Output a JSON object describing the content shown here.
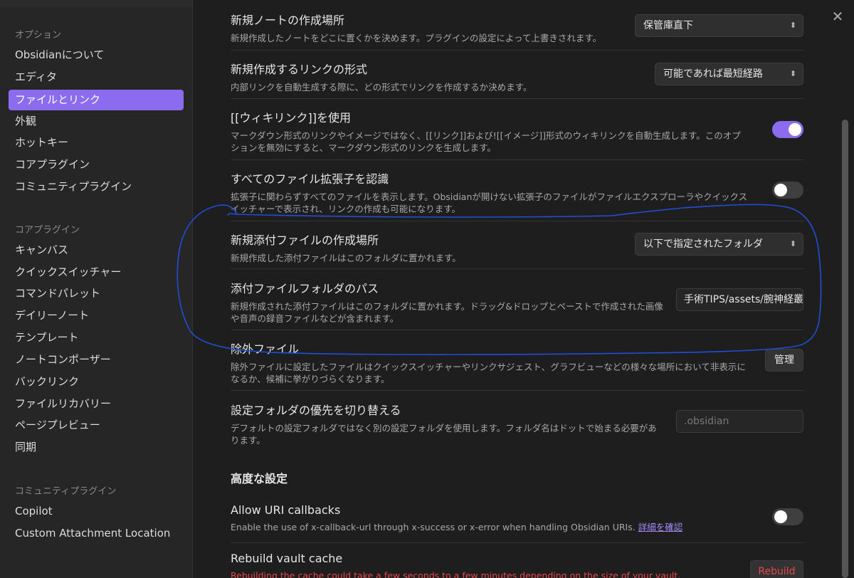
{
  "sidebar": {
    "groups": [
      {
        "title": "オプション",
        "items": [
          "Obsidianについて",
          "エディタ",
          "ファイルとリンク",
          "外観",
          "ホットキー",
          "コアプラグイン",
          "コミュニティプラグイン"
        ]
      },
      {
        "title": "コアプラグイン",
        "items": [
          "キャンバス",
          "クイックスイッチャー",
          "コマンドパレット",
          "デイリーノート",
          "テンプレート",
          "ノートコンポーザー",
          "バックリンク",
          "ファイルリカバリー",
          "ページプレビュー",
          "同期"
        ]
      },
      {
        "title": "コミュニティプラグイン",
        "items": [
          "Copilot",
          "Custom Attachment Location"
        ]
      }
    ],
    "active_item": "ファイルとリンク"
  },
  "settings": {
    "new_note_location": {
      "name": "新規ノートの作成場所",
      "desc": "新規作成したノートをどこに置くかを決めます。プラグインの設定によって上書きされます。",
      "value": "保管庫直下"
    },
    "new_link_format": {
      "name": "新規作成するリンクの形式",
      "desc": "内部リンクを自動生成する際に、どの形式でリンクを作成するか決めます。",
      "value": "可能であれば最短経路"
    },
    "use_wikilinks": {
      "name": "[[ウィキリンク]]を使用",
      "desc": "マークダウン形式のリンクやイメージではなく、[[リンク]]および![[イメージ]]形式のウィキリンクを自動生成します。このオプションを無効にすると、マークダウン形式のリンクを生成します。",
      "enabled": true
    },
    "detect_all_extensions": {
      "name": "すべてのファイル拡張子を認識",
      "desc": "拡張子に関わらずすべてのファイルを表示します。Obsidianが開けない拡張子のファイルがファイルエクスプローラやクイックスイッチャーで表示され、リンクの作成も可能になります。",
      "enabled": false
    },
    "attachment_location": {
      "name": "新規添付ファイルの作成場所",
      "desc": "新規作成した添付ファイルはこのフォルダに置かれます。",
      "value": "以下で指定されたフォルダ"
    },
    "attachment_folder_path": {
      "name": "添付ファイルフォルダのパス",
      "desc": "新規作成された添付ファイルはこのフォルダに置かれます。ドラッグ&ドロップとペーストで作成された画像や音声の録音ファイルなどが含まれます。",
      "value": "手術TIPS/assets/腕神経叢"
    },
    "excluded_files": {
      "name": "除外ファイル",
      "desc": "除外ファイルに設定したファイルはクイックスイッチャーやリンクサジェスト、グラフビューなどの様々な場所において非表示になるか、候補に挙がりづらくなります。",
      "button": "管理"
    },
    "override_config_folder": {
      "name": "設定フォルダの優先を切り替える",
      "desc": "デフォルトの設定フォルダではなく別の設定フォルダを使用します。フォルダ名はドットで始まる必要があります。",
      "placeholder": ".obsidian"
    },
    "advanced_heading": "高度な設定",
    "uri_callbacks": {
      "name": "Allow URI callbacks",
      "desc": "Enable the use of x-callback-url through x-success or x-error when handling Obsidian URIs.",
      "link": "詳細を確認",
      "enabled": false
    },
    "rebuild_cache": {
      "name": "Rebuild vault cache",
      "desc": "Rebuilding the cache could take a few seconds to a few minutes depending on the size of your vault.",
      "button": "Rebuild"
    }
  },
  "colors": {
    "accent": "#8b6cef",
    "danger": "#e5484d",
    "annotation": "#1f4fd6"
  }
}
